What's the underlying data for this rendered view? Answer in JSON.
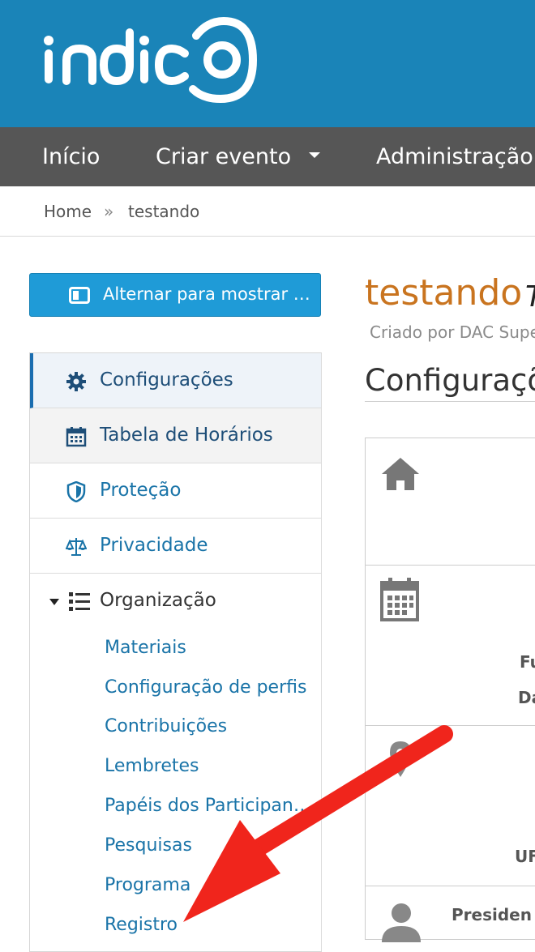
{
  "header": {
    "logo_text": "indico"
  },
  "nav": {
    "items": [
      {
        "label": "Início"
      },
      {
        "label": "Criar evento"
      },
      {
        "label": "Administração"
      }
    ]
  },
  "breadcrumb": {
    "home": "Home",
    "separator": "»",
    "current": "testando"
  },
  "sidebar": {
    "toggle_label": "Alternar para mostrar …",
    "items": [
      {
        "label": "Configurações"
      },
      {
        "label": "Tabela de Horários"
      },
      {
        "label": "Proteção"
      },
      {
        "label": "Privacidade"
      }
    ],
    "organization": {
      "label": "Organização",
      "children": [
        {
          "label": "Materiais"
        },
        {
          "label": "Configuração de perfis"
        },
        {
          "label": "Contribuições"
        },
        {
          "label": "Lembretes"
        },
        {
          "label": "Papéis dos Participan…"
        },
        {
          "label": "Pesquisas"
        },
        {
          "label": "Programa"
        },
        {
          "label": "Registro"
        }
      ]
    }
  },
  "main": {
    "event_title": "testando",
    "event_title_extra": "T",
    "created_by": "Criado por DAC Supe",
    "section_title": "Configuraçõ",
    "fragments": {
      "f1": "Fu",
      "f2": "Da",
      "f3": "UF",
      "f4": "Presiden"
    }
  },
  "colors": {
    "header_bg": "#1a84b8",
    "nav_bg": "#565656",
    "accent_blue": "#1a74a8",
    "button_blue": "#1f9bd7",
    "title_orange": "#c9741f",
    "annotation_red": "#f0251c"
  },
  "icons": {
    "logo": "indico-logo",
    "toggle": "toggle-window-icon",
    "settings": "gear-icon",
    "timetable": "calendar-icon",
    "protection": "shield-icon",
    "privacy": "scale-icon",
    "organization_caret": "caret-down-icon",
    "organization": "list-icon",
    "home": "home-icon",
    "calendar": "calendar-icon",
    "location": "map-marker-icon",
    "person": "user-icon",
    "annotation": "red-arrow"
  }
}
